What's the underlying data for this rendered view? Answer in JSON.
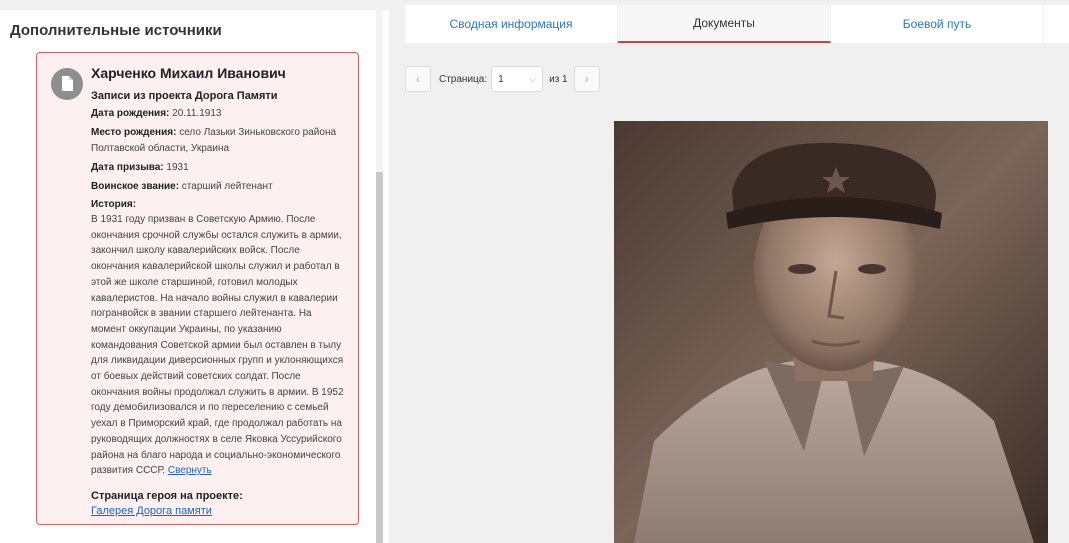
{
  "left": {
    "title": "Дополнительные источники",
    "card": {
      "name": "Харченко Михаил Иванович",
      "project": "Записи из проекта Дорога Памяти",
      "birth_label": "Дата рождения:",
      "birth_value": " 20.11.1913",
      "place_label": "Место рождения:",
      "place_value": " село Лазьки Зиньковского района Полтавской области, Украина",
      "draft_label": "Дата призыва:",
      "draft_value": " 1931",
      "rank_label": "Воинское звание:",
      "rank_value": " старший лейтенант",
      "history_label": "История:",
      "history_text": "В 1931 году призван в Советскую Армию. После окончания срочной службы остался служить в армии, закончил школу кавалерийских войск. После окончания кавалерийской школы служил и работал в этой же школе старшиной, готовил молодых кавалеристов. На начало войны служил в кавалерии погранвойск в звании старшего лейтенанта. На момент оккупации Украины, по указанию командования Советской армии был оставлен в тылу для ликвидации диверсионных групп и уклоняющихся от боевых действий советских солдат. После окончания войны продолжал служить в армии. В 1952 году демобилизовался и по переселению с семьей уехал в Приморский край, где продолжал работать на руководящих должностях в селе Яковка Уссурийского района на благо народа и социально-экономического развития СССР.",
      "collapse_link": "Свернуть",
      "hero_label": "Страница героя на проекте:",
      "gallery_link": "Галерея Дорога памяти"
    }
  },
  "tabs": [
    "Сводная информация",
    "Документы",
    "Боевой путь"
  ],
  "active_tab": "Документы",
  "pager": {
    "page_label": "Страница:",
    "current_page": "1",
    "of_label": "из 1"
  },
  "icons": {
    "document": "document-icon",
    "prev": "chevron-left-icon",
    "next": "chevron-right-icon",
    "dropdown": "chevron-down-icon"
  },
  "colors": {
    "card_border": "#d9625f",
    "card_bg": "#fcf0f0",
    "link": "#1e63c8",
    "tab_link": "#2a7ab8",
    "active_underline": "#d23f3f"
  }
}
